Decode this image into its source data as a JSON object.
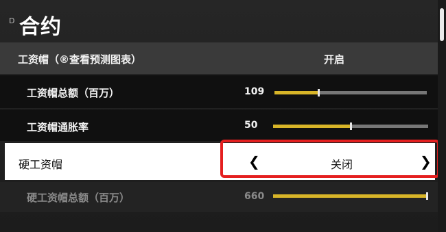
{
  "header": {
    "glyph": "D",
    "title": "合约"
  },
  "settings": [
    {
      "label": "工资帽（®查看预测图表）",
      "value": "开启"
    },
    {
      "label": "工资帽总额（百万）",
      "number": "109",
      "slider_fraction": 0.29
    },
    {
      "label": "工资帽通胀率",
      "number": "50",
      "slider_fraction": 0.5
    },
    {
      "label": "硬工资帽",
      "value": "关闭",
      "arrow_left": "❮",
      "arrow_right": "❯"
    },
    {
      "label": "硬工资帽总额（百万）",
      "number": "660",
      "slider_fraction": 1.0
    }
  ],
  "colors": {
    "slider_fill": "#d8b528",
    "highlight_border": "#e41f1f"
  }
}
